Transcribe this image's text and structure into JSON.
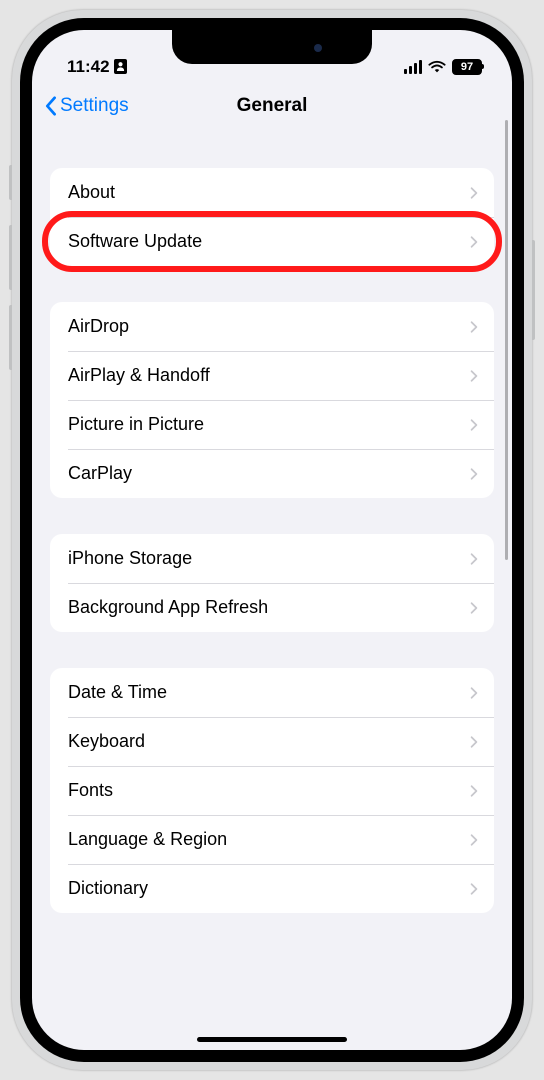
{
  "status": {
    "time": "11:42",
    "battery_pct": "97"
  },
  "nav": {
    "back_label": "Settings",
    "title": "General"
  },
  "groups": [
    {
      "rows": [
        {
          "id": "about",
          "label": "About"
        },
        {
          "id": "software-update",
          "label": "Software Update",
          "highlighted": true
        }
      ]
    },
    {
      "rows": [
        {
          "id": "airdrop",
          "label": "AirDrop"
        },
        {
          "id": "airplay-handoff",
          "label": "AirPlay & Handoff"
        },
        {
          "id": "picture-in-picture",
          "label": "Picture in Picture"
        },
        {
          "id": "carplay",
          "label": "CarPlay"
        }
      ]
    },
    {
      "rows": [
        {
          "id": "iphone-storage",
          "label": "iPhone Storage"
        },
        {
          "id": "background-app-refresh",
          "label": "Background App Refresh"
        }
      ]
    },
    {
      "rows": [
        {
          "id": "date-time",
          "label": "Date & Time"
        },
        {
          "id": "keyboard",
          "label": "Keyboard"
        },
        {
          "id": "fonts",
          "label": "Fonts"
        },
        {
          "id": "language-region",
          "label": "Language & Region"
        },
        {
          "id": "dictionary",
          "label": "Dictionary"
        }
      ]
    }
  ],
  "colors": {
    "link": "#007aff",
    "highlight": "#ff1a1a",
    "bg": "#f2f2f7"
  }
}
